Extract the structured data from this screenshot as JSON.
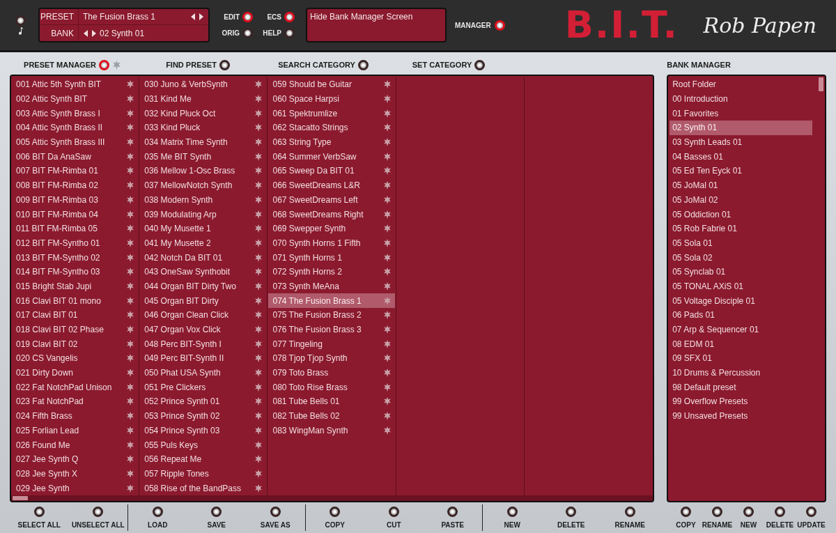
{
  "header": {
    "preset_label": "PRESET",
    "preset_name": "The Fusion Brass 1",
    "bank_label": "BANK",
    "bank_name": "02 Synth 01",
    "toggles": [
      {
        "label": "EDIT",
        "on": true
      },
      {
        "label": "ORIG",
        "on": false
      },
      {
        "label": "ECS",
        "on": true
      },
      {
        "label": "HELP",
        "on": false
      }
    ],
    "info_text": "Hide Bank Manager Screen",
    "manager": {
      "label": "MANAGER",
      "on": true
    },
    "logo": "B.I.T.",
    "brand": "Rob Papen"
  },
  "sections": [
    {
      "label": "PRESET MANAGER",
      "on": true,
      "star": true
    },
    {
      "label": "FIND PRESET",
      "on": false,
      "star": false
    },
    {
      "label": "SEARCH CATEGORY",
      "on": false,
      "star": false
    },
    {
      "label": "SET CATEGORY",
      "on": false,
      "star": false
    }
  ],
  "bank_manager_title": "BANK MANAGER",
  "preset_columns": [
    [
      {
        "label": "001 Attic 5th Synth BIT",
        "selected": false
      },
      {
        "label": "002 Attic Synth BIT",
        "selected": false
      },
      {
        "label": "003 Attic Synth Brass I",
        "selected": false
      },
      {
        "label": "004 Attic Synth Brass II",
        "selected": false
      },
      {
        "label": "005 Attic Synth Brass III",
        "selected": false
      },
      {
        "label": "006 BIT Da AnaSaw",
        "selected": false
      },
      {
        "label": "007 BIT FM-Rimba 01",
        "selected": false
      },
      {
        "label": "008 BIT FM-Rimba 02",
        "selected": false
      },
      {
        "label": "009 BIT FM-Rimba 03",
        "selected": false
      },
      {
        "label": "010 BIT FM-Rimba 04",
        "selected": false
      },
      {
        "label": "011 BIT FM-Rimba 05",
        "selected": false
      },
      {
        "label": "012 BIT FM-Syntho 01",
        "selected": false
      },
      {
        "label": "013 BIT FM-Syntho 02",
        "selected": false
      },
      {
        "label": "014 BIT FM-Syntho 03",
        "selected": false
      },
      {
        "label": "015 Bright Stab Jupi",
        "selected": false
      },
      {
        "label": "016 Clavi BIT 01 mono",
        "selected": false
      },
      {
        "label": "017 Clavi BIT 01",
        "selected": false
      },
      {
        "label": "018 Clavi BIT 02 Phase",
        "selected": false
      },
      {
        "label": "019 Clavi BIT 02",
        "selected": false
      },
      {
        "label": "020 CS Vangelis",
        "selected": false
      },
      {
        "label": "021 Dirty Down",
        "selected": false
      },
      {
        "label": "022 Fat NotchPad Unison",
        "selected": false
      },
      {
        "label": "023 Fat NotchPad",
        "selected": false
      },
      {
        "label": "024 Fifth Brass",
        "selected": false
      },
      {
        "label": "025 Forlian Lead",
        "selected": false
      },
      {
        "label": "026 Found Me",
        "selected": false
      },
      {
        "label": "027 Jee Synth Q",
        "selected": false
      },
      {
        "label": "028 Jee Synth X",
        "selected": false
      },
      {
        "label": "029 Jee Synth",
        "selected": false
      }
    ],
    [
      {
        "label": "030 Juno & VerbSynth",
        "selected": false
      },
      {
        "label": "031 Kind Me",
        "selected": false
      },
      {
        "label": "032 Kind Pluck Oct",
        "selected": false
      },
      {
        "label": "033 Kind Pluck",
        "selected": false
      },
      {
        "label": "034 Matrix Time Synth",
        "selected": false
      },
      {
        "label": "035 Me BIT Synth",
        "selected": false
      },
      {
        "label": "036 Mellow 1-Osc Brass",
        "selected": false
      },
      {
        "label": "037 MellowNotch Synth",
        "selected": false
      },
      {
        "label": "038 Modern Synth",
        "selected": false
      },
      {
        "label": "039 Modulating Arp",
        "selected": false
      },
      {
        "label": "040 My Musette 1",
        "selected": false
      },
      {
        "label": "041 My Musette 2",
        "selected": false
      },
      {
        "label": "042 Notch Da BIT 01",
        "selected": false
      },
      {
        "label": "043 OneSaw Synthobit",
        "selected": false
      },
      {
        "label": "044 Organ BIT Dirty Two",
        "selected": false
      },
      {
        "label": "045 Organ BIT Dirty",
        "selected": false
      },
      {
        "label": "046 Organ Clean Click",
        "selected": false
      },
      {
        "label": "047 Organ Vox Click",
        "selected": false
      },
      {
        "label": "048 Perc BIT-Synth I",
        "selected": false
      },
      {
        "label": "049 Perc BIT-Synth II",
        "selected": false
      },
      {
        "label": "050 Phat USA Synth",
        "selected": false
      },
      {
        "label": "051 Pre Clickers",
        "selected": false
      },
      {
        "label": "052 Prince Synth 01",
        "selected": false
      },
      {
        "label": "053 Prince Synth 02",
        "selected": false
      },
      {
        "label": "054 Prince Synth 03",
        "selected": false
      },
      {
        "label": "055 Puls Keys",
        "selected": false
      },
      {
        "label": "056 Repeat Me",
        "selected": false
      },
      {
        "label": "057 Ripple Tones",
        "selected": false
      },
      {
        "label": "058 Rise of the BandPass",
        "selected": false
      }
    ],
    [
      {
        "label": "059 Should be Guitar",
        "selected": false
      },
      {
        "label": "060 Space Harpsi",
        "selected": false
      },
      {
        "label": "061 Spektrumlize",
        "selected": false
      },
      {
        "label": "062 Stacatto Strings",
        "selected": false
      },
      {
        "label": "063 String Type",
        "selected": false
      },
      {
        "label": "064 Summer VerbSaw",
        "selected": false
      },
      {
        "label": "065 Sweep Da BIT 01",
        "selected": false
      },
      {
        "label": "066 SweetDreams L&R",
        "selected": false
      },
      {
        "label": "067 SweetDreams Left",
        "selected": false
      },
      {
        "label": "068 SweetDreams Right",
        "selected": false
      },
      {
        "label": "069 Swepper Synth",
        "selected": false
      },
      {
        "label": "070 Synth Horns 1 Fifth",
        "selected": false
      },
      {
        "label": "071 Synth Horns 1",
        "selected": false
      },
      {
        "label": "072 Synth Horns 2",
        "selected": false
      },
      {
        "label": "073 Synth MeAna",
        "selected": false
      },
      {
        "label": "074 The Fusion Brass 1",
        "selected": true
      },
      {
        "label": "075 The Fusion Brass 2",
        "selected": false
      },
      {
        "label": "076 The Fusion Brass 3",
        "selected": false
      },
      {
        "label": "077 Tingeling",
        "selected": false
      },
      {
        "label": "078 Tjop Tjop Synth",
        "selected": false
      },
      {
        "label": "079 Toto Brass",
        "selected": false
      },
      {
        "label": "080 Toto Rise Brass",
        "selected": false
      },
      {
        "label": "081 Tube Bells 01",
        "selected": false
      },
      {
        "label": "082 Tube Bells 02",
        "selected": false
      },
      {
        "label": "083 WingMan Synth",
        "selected": false
      }
    ]
  ],
  "banks": [
    {
      "label": "Root Folder",
      "selected": false
    },
    {
      "label": "00 Introduction",
      "selected": false
    },
    {
      "label": "01 Favorites",
      "selected": false
    },
    {
      "label": "02 Synth 01",
      "selected": true
    },
    {
      "label": "03 Synth Leads 01",
      "selected": false
    },
    {
      "label": "04 Basses 01",
      "selected": false
    },
    {
      "label": "05 Ed Ten Eyck 01",
      "selected": false
    },
    {
      "label": "05 JoMal 01",
      "selected": false
    },
    {
      "label": "05 JoMal 02",
      "selected": false
    },
    {
      "label": "05 Oddiction 01",
      "selected": false
    },
    {
      "label": "05 Rob Fabrie 01",
      "selected": false
    },
    {
      "label": "05 Sola 01",
      "selected": false
    },
    {
      "label": "05 Sola 02",
      "selected": false
    },
    {
      "label": "05 Synclab 01",
      "selected": false
    },
    {
      "label": "05 TONAL AXiS 01",
      "selected": false
    },
    {
      "label": "05 Voltage Disciple 01",
      "selected": false
    },
    {
      "label": "06 Pads 01",
      "selected": false
    },
    {
      "label": "07 Arp & Sequencer 01",
      "selected": false
    },
    {
      "label": "08 EDM 01",
      "selected": false
    },
    {
      "label": "09 SFX 01",
      "selected": false
    },
    {
      "label": "10 Drums & Percussion",
      "selected": false
    },
    {
      "label": "98 Default preset",
      "selected": false
    },
    {
      "label": "99 Overflow Presets",
      "selected": false
    },
    {
      "label": "99 Unsaved Presets",
      "selected": false
    }
  ],
  "preset_actions": [
    [
      "SELECT ALL",
      "UNSELECT ALL"
    ],
    [
      "LOAD",
      "SAVE",
      "SAVE AS"
    ],
    [
      "COPY",
      "CUT",
      "PASTE"
    ],
    [
      "NEW",
      "DELETE",
      "RENAME"
    ]
  ],
  "bank_actions": [
    "COPY",
    "RENAME",
    "NEW",
    "DELETE",
    "UPDATE"
  ]
}
